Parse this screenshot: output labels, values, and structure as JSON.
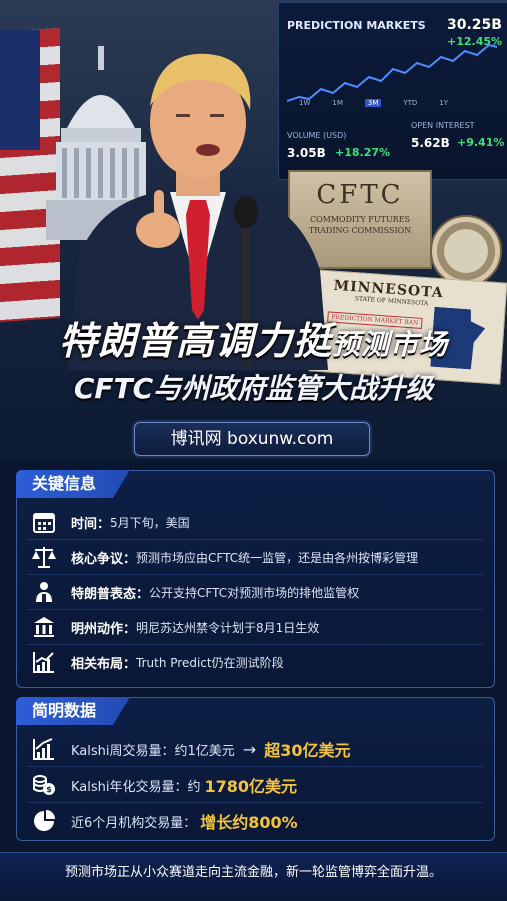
{
  "hero": {
    "market_screen": {
      "title": "PREDICTION MARKETS",
      "main_value": "30.25B",
      "main_change": "+12.45%",
      "tabs": [
        "1W",
        "1M",
        "3M",
        "YTD",
        "1Y"
      ],
      "active_tab": "3M",
      "volume_label": "VOLUME (USD)",
      "volume_value": "3.05B",
      "volume_change": "+18.27%",
      "oi_label": "OPEN INTEREST",
      "oi_value": "5.62B",
      "oi_change": "+9.41%"
    },
    "cftc_plate": {
      "big": "CFTC",
      "line1": "COMMODITY FUTURES",
      "line2": "TRADING COMMISSION"
    },
    "mn_doc": {
      "title": "MINNESOTA",
      "subtitle": "STATE OF MINNESOTA",
      "stamp": "PREDICTION MARKET BAN"
    },
    "title_line1_big": "特朗普高调力挺",
    "title_line1_small": "预测市场",
    "title_line2": "CFTC与州政府监管大战升级",
    "site": "博讯网 boxunw.com"
  },
  "key_info": {
    "header": "关键信息",
    "rows": [
      {
        "icon": "calendar-icon",
        "label": "时间：",
        "value": "5月下旬，美国"
      },
      {
        "icon": "scales-icon",
        "label": "核心争议：",
        "value": "预测市场应由CFTC统一监管，还是由各州按博彩管理"
      },
      {
        "icon": "speaker-icon",
        "label": "特朗普表态：",
        "value": "公开支持CFTC对预测市场的排他监管权"
      },
      {
        "icon": "government-building-icon",
        "label": "明州动作：",
        "value": "明尼苏达州禁令计划于8月1日生效"
      },
      {
        "icon": "growth-chart-icon",
        "label": "相关布局：",
        "value": "Truth Predict仍在测试阶段"
      }
    ]
  },
  "brief_data": {
    "header": "简明数据",
    "rows": [
      {
        "icon": "bar-chart-icon",
        "prefix": "Kalshi周交易量：约1亿美元",
        "arrow": "→",
        "highlight": "超30亿美元"
      },
      {
        "icon": "coins-icon",
        "prefix": "Kalshi年化交易量：约",
        "highlight": "1780亿美元"
      },
      {
        "icon": "pie-chart-icon",
        "prefix": "近6个月机构交易量：",
        "highlight": "增长约800%"
      }
    ]
  },
  "footer": "预测市场正从小众赛道走向主流金融，新一轮监管博弈全面升温。",
  "colors": {
    "accent": "#2d5ed8",
    "highlight": "#f5c33b",
    "positive": "#3ee07a"
  }
}
